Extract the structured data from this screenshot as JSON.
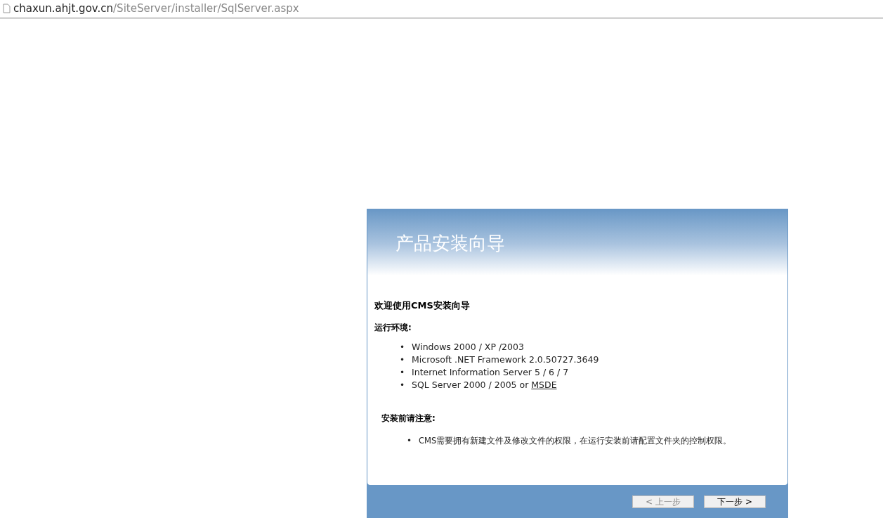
{
  "address_bar": {
    "host": "chaxun.ahjt.gov.cn",
    "path": "/SiteServer/installer/SqlServer.aspx"
  },
  "wizard": {
    "title": "产品安装向导",
    "welcome": "欢迎使用CMS安装向导",
    "requirements_heading": "运行环境:",
    "requirements": [
      {
        "marker": "•",
        "text": "Windows 2000 / XP /2003"
      },
      {
        "marker": "•",
        "text": "Microsoft .NET Framework 2.0.50727.3649"
      },
      {
        "marker": "•",
        "text": "Internet Information Server 5 / 6 / 7"
      },
      {
        "marker": "•",
        "text": "SQL Server 2000 / 2005 or ",
        "link": "MSDE"
      }
    ],
    "notes_heading": "安装前请注意:",
    "notes": [
      {
        "marker": "•",
        "text": "CMS需要拥有新建文件及修改文件的权限，在运行安装前请配置文件夹的控制权限。"
      }
    ],
    "buttons": [
      {
        "label": "< 上一步",
        "disabled": true
      },
      {
        "label": "下一步 >",
        "disabled": false
      }
    ]
  }
}
